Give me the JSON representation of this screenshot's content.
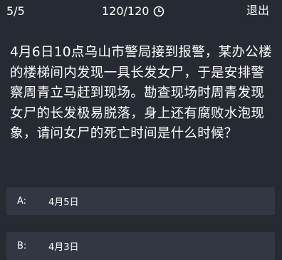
{
  "header": {
    "progress": "5/5",
    "timer": "120/120",
    "timer_icon": "clock-icon",
    "exit_label": "退出"
  },
  "question": {
    "text": "4月6日10点乌山市警局接到报警，某办公楼的楼梯间内发现一具长发女尸，于是安排警察周青立马赶到现场。勘查现场时周青发现女尸的长发极易脱落，身上还有腐败水泡现象，请问女尸的死亡时间是什么时候？"
  },
  "options": [
    {
      "letter": "A:",
      "text": "4月5日"
    },
    {
      "letter": "B:",
      "text": "4月3日"
    }
  ]
}
